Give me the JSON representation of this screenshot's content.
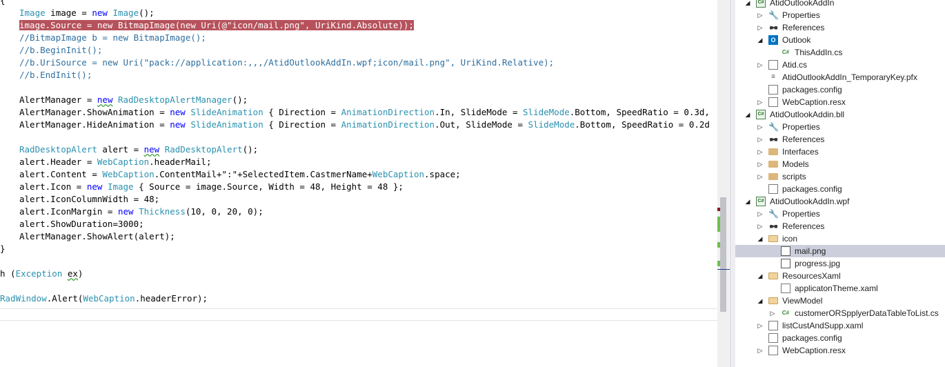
{
  "editor": {
    "lines": [
      {
        "indent": 0,
        "tokens": [
          {
            "t": "{",
            "c": "plain"
          }
        ]
      },
      {
        "indent": 28,
        "tokens": [
          {
            "t": "Image",
            "c": "ty"
          },
          {
            "t": " image = ",
            "c": "plain"
          },
          {
            "t": "new",
            "c": "kw"
          },
          {
            "t": " ",
            "c": "plain"
          },
          {
            "t": "Image",
            "c": "ty"
          },
          {
            "t": "();",
            "c": "plain"
          }
        ]
      },
      {
        "indent": 28,
        "highlight": true,
        "tokens": [
          {
            "t": "image.Source = new BitmapImage(new Uri(@\"icon/mail.png\", UriKind.Absolute));",
            "c": "plain"
          }
        ]
      },
      {
        "indent": 28,
        "tokens": [
          {
            "t": "//BitmapImage b = new BitmapImage();",
            "c": "cm"
          }
        ]
      },
      {
        "indent": 28,
        "tokens": [
          {
            "t": "//b.BeginInit();",
            "c": "cm"
          }
        ]
      },
      {
        "indent": 28,
        "tokens": [
          {
            "t": "//b.UriSource = new Uri(\"pack://application:,,,/AtidOutlookAddIn.wpf;icon/mail.png\", UriKind.Relative);",
            "c": "cm"
          }
        ]
      },
      {
        "indent": 28,
        "tokens": [
          {
            "t": "//b.EndInit();",
            "c": "cm"
          }
        ]
      },
      {
        "indent": 28,
        "tokens": []
      },
      {
        "indent": 28,
        "tokens": [
          {
            "t": "AlertManager = ",
            "c": "plain"
          },
          {
            "t": "new",
            "c": "kw",
            "sq": true
          },
          {
            "t": " ",
            "c": "plain"
          },
          {
            "t": "RadDesktopAlertManager",
            "c": "ty"
          },
          {
            "t": "();",
            "c": "plain"
          }
        ]
      },
      {
        "indent": 28,
        "tokens": [
          {
            "t": "AlertManager.ShowAnimation = ",
            "c": "plain"
          },
          {
            "t": "new",
            "c": "kw"
          },
          {
            "t": " ",
            "c": "plain"
          },
          {
            "t": "SlideAnimation",
            "c": "ty"
          },
          {
            "t": " { Direction = ",
            "c": "plain"
          },
          {
            "t": "AnimationDirection",
            "c": "ty"
          },
          {
            "t": ".In, SlideMode = ",
            "c": "plain"
          },
          {
            "t": "SlideMode",
            "c": "ty"
          },
          {
            "t": ".Bottom, SpeedRatio = 0.3d,",
            "c": "plain"
          }
        ]
      },
      {
        "indent": 28,
        "tokens": [
          {
            "t": "AlertManager.HideAnimation = ",
            "c": "plain"
          },
          {
            "t": "new",
            "c": "kw"
          },
          {
            "t": " ",
            "c": "plain"
          },
          {
            "t": "SlideAnimation",
            "c": "ty"
          },
          {
            "t": " { Direction = ",
            "c": "plain"
          },
          {
            "t": "AnimationDirection",
            "c": "ty"
          },
          {
            "t": ".Out, SlideMode = ",
            "c": "plain"
          },
          {
            "t": "SlideMode",
            "c": "ty"
          },
          {
            "t": ".Bottom, SpeedRatio = 0.2d",
            "c": "plain"
          }
        ]
      },
      {
        "indent": 28,
        "tokens": []
      },
      {
        "indent": 28,
        "tokens": [
          {
            "t": "RadDesktopAlert",
            "c": "ty"
          },
          {
            "t": " alert = ",
            "c": "plain"
          },
          {
            "t": "new",
            "c": "kw",
            "sq": true
          },
          {
            "t": " ",
            "c": "plain"
          },
          {
            "t": "RadDesktopAlert",
            "c": "ty"
          },
          {
            "t": "();",
            "c": "plain"
          }
        ]
      },
      {
        "indent": 28,
        "tokens": [
          {
            "t": "alert.Header = ",
            "c": "plain"
          },
          {
            "t": "WebCaption",
            "c": "ty"
          },
          {
            "t": ".headerMail;",
            "c": "plain"
          }
        ]
      },
      {
        "indent": 28,
        "tokens": [
          {
            "t": "alert.Content = ",
            "c": "plain"
          },
          {
            "t": "WebCaption",
            "c": "ty"
          },
          {
            "t": ".ContentMail+\":\"+SelectedItem.CastmerName+",
            "c": "plain"
          },
          {
            "t": "WebCaption",
            "c": "ty"
          },
          {
            "t": ".space;",
            "c": "plain"
          }
        ]
      },
      {
        "indent": 28,
        "tokens": [
          {
            "t": "alert.Icon = ",
            "c": "plain"
          },
          {
            "t": "new",
            "c": "kw"
          },
          {
            "t": " ",
            "c": "plain"
          },
          {
            "t": "Image",
            "c": "ty"
          },
          {
            "t": " { Source = image.Source, Width = 48, Height = 48 };",
            "c": "plain"
          }
        ]
      },
      {
        "indent": 28,
        "tokens": [
          {
            "t": "alert.IconColumnWidth = 48;",
            "c": "plain"
          }
        ]
      },
      {
        "indent": 28,
        "tokens": [
          {
            "t": "alert.IconMargin = ",
            "c": "plain"
          },
          {
            "t": "new",
            "c": "kw"
          },
          {
            "t": " ",
            "c": "plain"
          },
          {
            "t": "Thickness",
            "c": "ty"
          },
          {
            "t": "(10, 0, 20, 0);",
            "c": "plain"
          }
        ]
      },
      {
        "indent": 28,
        "tokens": [
          {
            "t": "alert.ShowDuration=3000;",
            "c": "plain"
          }
        ]
      },
      {
        "indent": 28,
        "tokens": [
          {
            "t": "AlertManager.ShowAlert(alert);",
            "c": "plain"
          }
        ]
      },
      {
        "indent": 0,
        "tokens": [
          {
            "t": "}",
            "c": "plain"
          }
        ]
      },
      {
        "indent": 0,
        "tokens": []
      },
      {
        "indent": 0,
        "tokens": [
          {
            "t": "h (",
            "c": "plain"
          },
          {
            "t": "Exception",
            "c": "ty"
          },
          {
            "t": " ",
            "c": "plain"
          },
          {
            "t": "ex",
            "c": "plain",
            "sq": true
          },
          {
            "t": ")",
            "c": "plain"
          }
        ]
      },
      {
        "indent": 0,
        "tokens": []
      },
      {
        "indent": 0,
        "tokens": [
          {
            "t": "RadWindow",
            "c": "ty"
          },
          {
            "t": ".Alert(",
            "c": "plain"
          },
          {
            "t": "WebCaption",
            "c": "ty"
          },
          {
            "t": ".headerError);",
            "c": "plain"
          }
        ]
      }
    ]
  },
  "scrollbar": {
    "marks": [
      {
        "color": "#8b1a1a",
        "pos": 0.566
      },
      {
        "color": "#6fbf4a",
        "pos": 0.59
      },
      {
        "color": "#6fbf4a",
        "pos": 0.66
      },
      {
        "color": "#6fbf4a",
        "pos": 0.71
      }
    ]
  },
  "tree": {
    "items": [
      {
        "level": 0,
        "arrow": "open",
        "icon": "project-icon",
        "label": "AtidOutlookAddIn"
      },
      {
        "level": 1,
        "arrow": "closed",
        "icon": "wrench-icon",
        "label": "Properties"
      },
      {
        "level": 1,
        "arrow": "closed",
        "icon": "references-icon",
        "label": "References"
      },
      {
        "level": 1,
        "arrow": "open",
        "icon": "outlook-icon",
        "label": "Outlook"
      },
      {
        "level": 2,
        "arrow": "",
        "icon": "csharp-file-icon",
        "label": "ThisAddIn.cs"
      },
      {
        "level": 1,
        "arrow": "closed",
        "icon": "file-icon",
        "label": "Atid.cs"
      },
      {
        "level": 1,
        "arrow": "",
        "icon": "key-icon",
        "label": "AtidOutlookAddIn_TemporaryKey.pfx"
      },
      {
        "level": 1,
        "arrow": "",
        "icon": "config-icon",
        "label": "packages.config"
      },
      {
        "level": 1,
        "arrow": "closed",
        "icon": "resx-icon",
        "label": "WebCaption.resx"
      },
      {
        "level": 0,
        "arrow": "open",
        "icon": "project-icon",
        "label": "AtidOutlookAddin.bll"
      },
      {
        "level": 1,
        "arrow": "closed",
        "icon": "wrench-icon",
        "label": "Properties"
      },
      {
        "level": 1,
        "arrow": "closed",
        "icon": "references-icon",
        "label": "References"
      },
      {
        "level": 1,
        "arrow": "closed",
        "icon": "folder-icon",
        "label": "Interfaces"
      },
      {
        "level": 1,
        "arrow": "closed",
        "icon": "folder-icon",
        "label": "Models"
      },
      {
        "level": 1,
        "arrow": "closed",
        "icon": "folder-icon",
        "label": "scripts"
      },
      {
        "level": 1,
        "arrow": "",
        "icon": "config-icon",
        "label": "packages.config"
      },
      {
        "level": 0,
        "arrow": "open",
        "icon": "project-icon",
        "label": "AtidOutlookAddIn.wpf"
      },
      {
        "level": 1,
        "arrow": "closed",
        "icon": "wrench-icon",
        "label": "Properties"
      },
      {
        "level": 1,
        "arrow": "closed",
        "icon": "references-icon",
        "label": "References"
      },
      {
        "level": 1,
        "arrow": "open",
        "icon": "folder-open-icon",
        "label": "icon"
      },
      {
        "level": 2,
        "arrow": "",
        "icon": "image-file-icon",
        "label": "mail.png",
        "selected": true
      },
      {
        "level": 2,
        "arrow": "",
        "icon": "image-file-icon",
        "label": "progress.jpg"
      },
      {
        "level": 1,
        "arrow": "open",
        "icon": "folder-open-icon",
        "label": "ResourcesXaml"
      },
      {
        "level": 2,
        "arrow": "",
        "icon": "xaml-file-icon",
        "label": "applicatonTheme.xaml"
      },
      {
        "level": 1,
        "arrow": "open",
        "icon": "folder-open-icon",
        "label": "ViewModel"
      },
      {
        "level": 2,
        "arrow": "closed",
        "icon": "csharp-file-icon",
        "label": "customerORSpplyerDataTableToList.cs"
      },
      {
        "level": 1,
        "arrow": "closed",
        "icon": "xaml-file-icon",
        "label": "listCustAndSupp.xaml"
      },
      {
        "level": 1,
        "arrow": "",
        "icon": "config-icon",
        "label": "packages.config"
      },
      {
        "level": 1,
        "arrow": "closed",
        "icon": "resx-icon",
        "label": "WebCaption.resx"
      }
    ]
  }
}
